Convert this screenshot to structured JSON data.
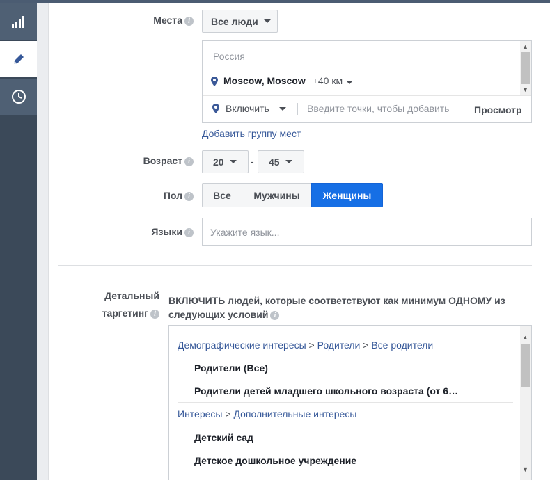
{
  "sidebar": {
    "items": [
      {
        "icon": "bar-chart-icon"
      },
      {
        "icon": "pencil-icon"
      },
      {
        "icon": "clock-icon"
      }
    ]
  },
  "places": {
    "label": "Места",
    "dropdown": "Все люди",
    "country": "Россия",
    "city": "Moscow, Moscow",
    "radius": "+40 км",
    "include_label": "Включить",
    "input_placeholder": "Введите точки, чтобы добавить",
    "browse": "Просмотр",
    "add_group_link": "Добавить группу мест"
  },
  "age": {
    "label": "Возраст",
    "from": "20",
    "separator": "-",
    "to": "45"
  },
  "gender": {
    "label": "Пол",
    "options": [
      "Все",
      "Мужчины",
      "Женщины"
    ],
    "selected": "Женщины"
  },
  "languages": {
    "label": "Языки",
    "placeholder": "Укажите язык..."
  },
  "detailed": {
    "label_line1": "Детальный",
    "label_line2": "таргетинг",
    "description_line1": "ВКЛЮЧИТЬ людей, которые соответствуют как минимум ОДНОМУ из",
    "description_line2": "следующих условий",
    "groups": [
      {
        "path_a": "Демографические интересы",
        "path_b": "Родители",
        "path_c": "Все родители",
        "items": [
          "Родители (Все)",
          "Родители детей младшего школьного возраста (от 6…"
        ]
      },
      {
        "path_a": "Интересы",
        "path_b": "Дополнительные интересы",
        "items": [
          "Детский сад",
          "Детское дошкольное учреждение"
        ]
      }
    ]
  },
  "colors": {
    "accent": "#166fe5",
    "link": "#365899",
    "sidebar": "#3b4959"
  }
}
